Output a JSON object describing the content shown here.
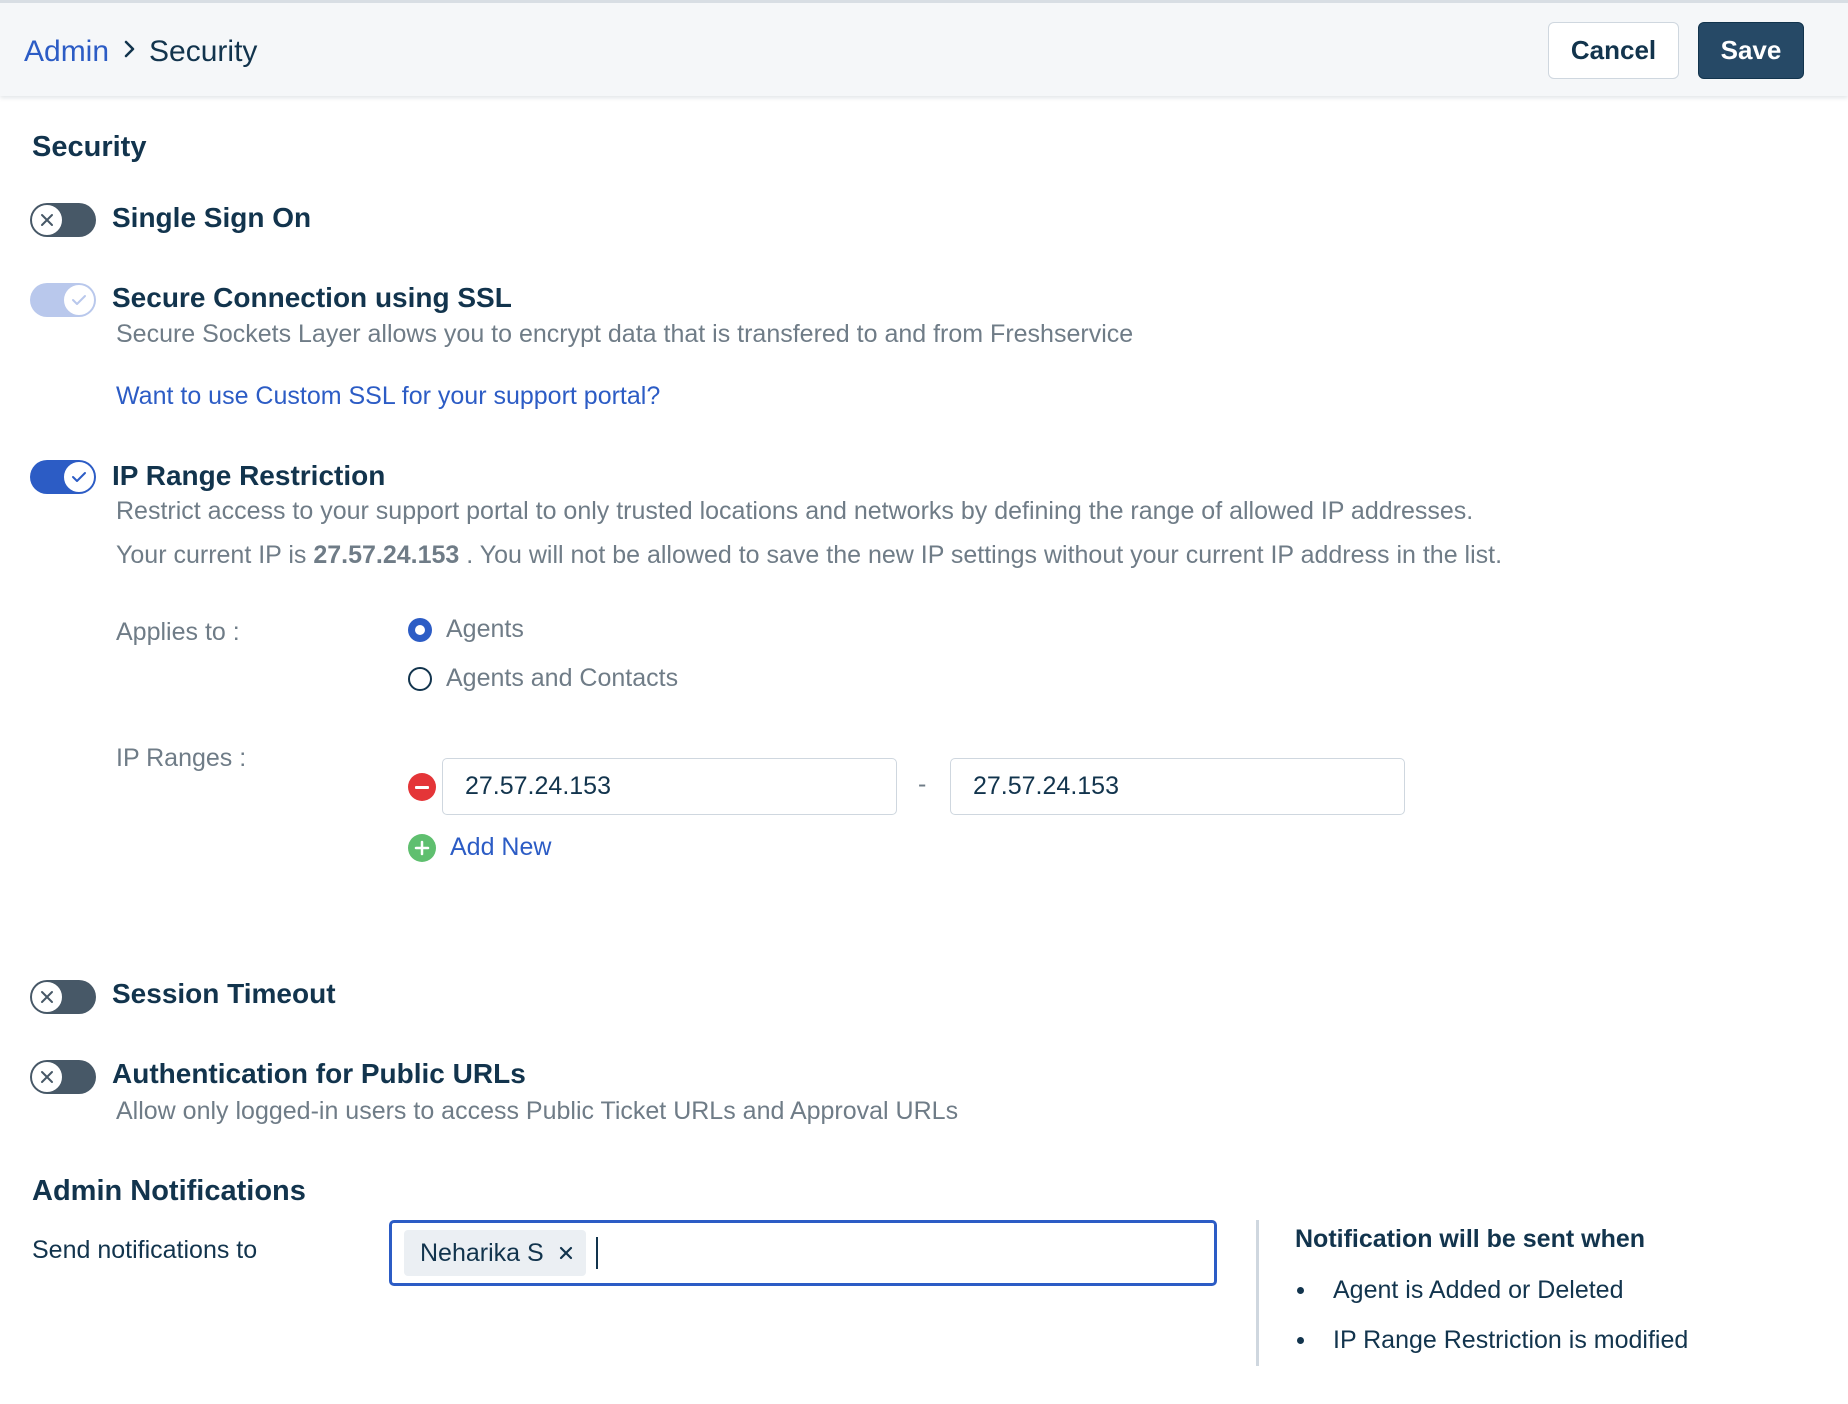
{
  "header": {
    "breadcrumb_parent": "Admin",
    "breadcrumb_current": "Security",
    "cancel_label": "Cancel",
    "save_label": "Save"
  },
  "page": {
    "section_title": "Security"
  },
  "features": {
    "sso": {
      "title": "Single Sign On",
      "enabled": false
    },
    "ssl": {
      "title": "Secure Connection using SSL",
      "enabled": true,
      "locked": true,
      "description": "Secure Sockets Layer allows you to encrypt data that is transfered to and from Freshservice",
      "custom_link": "Want to use Custom SSL for your support portal?"
    },
    "ip_range": {
      "title": "IP Range Restriction",
      "enabled": true,
      "description": "Restrict access to your support portal to only trusted locations and networks by defining the range of allowed IP addresses.",
      "current_ip_prefix": "Your current IP is",
      "current_ip": "27.57.24.153",
      "current_ip_suffix": ". You will not be allowed to save the new IP settings without your current IP address in the list.",
      "applies_to_label": "Applies to :",
      "applies_to_options": [
        "Agents",
        "Agents and Contacts"
      ],
      "applies_to_selected": "Agents",
      "ip_ranges_label": "IP Ranges :",
      "ranges": [
        {
          "from": "27.57.24.153",
          "to": "27.57.24.153"
        }
      ],
      "range_separator": "-",
      "add_new_label": "Add New"
    },
    "session_timeout": {
      "title": "Session Timeout",
      "enabled": false
    },
    "public_url_auth": {
      "title": "Authentication for Public URLs",
      "enabled": false,
      "description": "Allow only logged-in users to access Public Ticket URLs and Approval URLs"
    }
  },
  "admin_notifications": {
    "title": "Admin Notifications",
    "send_label": "Send notifications to",
    "recipients": [
      "Neharika S"
    ],
    "notice_title": "Notification will be sent when",
    "notice_items": [
      "Agent is Added or Deleted",
      "IP Range Restriction is modified"
    ]
  },
  "colors": {
    "primary": "#2c5cc5",
    "navy": "#12344d",
    "save_button": "#264966",
    "muted_text": "#6f7c87",
    "remove": "#e43538",
    "add": "#5fbf6f"
  },
  "icons": {
    "breadcrumb_separator": "chevron-right-icon",
    "toggle_off": "close-icon",
    "toggle_on": "check-icon",
    "remove_range": "minus-circle-icon",
    "add_range": "plus-circle-icon",
    "chip_remove": "close-icon"
  }
}
